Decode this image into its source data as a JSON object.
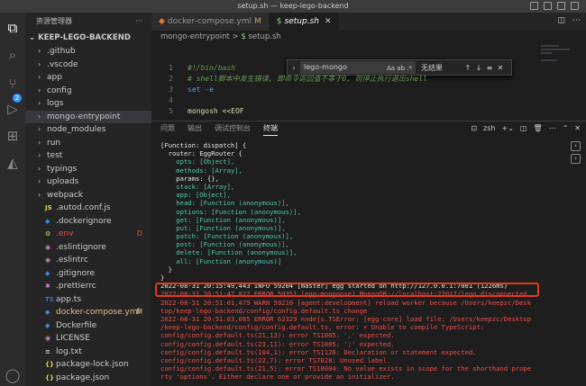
{
  "window": {
    "title": "setup.sh — keep-lego-backend"
  },
  "activity": {
    "scm_badge": "2"
  },
  "sidebar": {
    "header": "资源管理器",
    "more": "···",
    "root": "KEEP-LEGO-BACKEND",
    "items": [
      {
        "kind": "folder",
        "label": ".github",
        "badge": ""
      },
      {
        "kind": "folder",
        "label": ".vscode",
        "badge": ""
      },
      {
        "kind": "folder",
        "label": "app",
        "badge": ""
      },
      {
        "kind": "folder",
        "label": "config",
        "badge": ""
      },
      {
        "kind": "folder",
        "label": "logs",
        "badge": ""
      },
      {
        "kind": "folder",
        "label": "mongo-entrypoint",
        "badge": "",
        "selected": true
      },
      {
        "kind": "folder",
        "label": "node_modules",
        "badge": ""
      },
      {
        "kind": "folder",
        "label": "run",
        "badge": ""
      },
      {
        "kind": "folder",
        "label": "test",
        "badge": ""
      },
      {
        "kind": "folder",
        "label": "typings",
        "badge": ""
      },
      {
        "kind": "folder",
        "label": "uploads",
        "badge": ""
      },
      {
        "kind": "folder",
        "label": "webpack",
        "badge": ""
      },
      {
        "kind": "file",
        "icon": "JS",
        "label": ".autod.conf.js",
        "badge": ""
      },
      {
        "kind": "file",
        "icon": "◆",
        "label": ".dockerignore",
        "badge": ""
      },
      {
        "kind": "file",
        "icon": "⚙",
        "label": ".env",
        "badge": "D"
      },
      {
        "kind": "file",
        "icon": "◉",
        "label": ".eslintignore",
        "badge": ""
      },
      {
        "kind": "file",
        "icon": "◉",
        "label": ".eslintrc",
        "badge": ""
      },
      {
        "kind": "file",
        "icon": "◆",
        "label": ".gitignore",
        "badge": ""
      },
      {
        "kind": "file",
        "icon": "✱",
        "label": ".prettierrc",
        "badge": ""
      },
      {
        "kind": "file",
        "icon": "TS",
        "label": "app.ts",
        "badge": ""
      },
      {
        "kind": "file",
        "icon": "◆",
        "label": "docker-compose.yml",
        "badge": "M"
      },
      {
        "kind": "file",
        "icon": "◆",
        "label": "Dockerfile",
        "badge": ""
      },
      {
        "kind": "file",
        "icon": "◉",
        "label": "LICENSE",
        "badge": ""
      },
      {
        "kind": "file",
        "icon": "≡",
        "label": "log.txt",
        "badge": ""
      },
      {
        "kind": "file",
        "icon": "{}",
        "label": "package-lock.json",
        "badge": ""
      },
      {
        "kind": "file",
        "icon": "{}",
        "label": "package.json",
        "badge": ""
      },
      {
        "kind": "file",
        "icon": "ⓘ",
        "label": "README.md",
        "badge": ""
      }
    ]
  },
  "tabs": [
    {
      "label": "docker-compose.yml",
      "mark": "M",
      "icon": "◆",
      "active": false
    },
    {
      "label": "setup.sh",
      "mark": "",
      "icon": "$",
      "active": true
    }
  ],
  "breadcrumb": {
    "folder": "mongo-entrypoint",
    "sep": ">",
    "file": "setup.sh"
  },
  "find": {
    "value": "lego-mongo",
    "options": "Aa ab .*",
    "result": "无结果"
  },
  "code": [
    {
      "ln": "1",
      "text": "#!/bin/bash",
      "cls": "c-comment"
    },
    {
      "ln": "2",
      "text": "# shell脚本中发生错误, 即命令返回值不等于0, 则停止执行退出shell",
      "cls": "c-comment"
    },
    {
      "ln": "3",
      "text": "set -e",
      "cls": "c-kw"
    },
    {
      "ln": "4",
      "text": "",
      "cls": ""
    },
    {
      "ln": "5",
      "text": "mongosh <<EOF",
      "cls": "c-fn"
    }
  ],
  "panel": {
    "tabs": [
      "问题",
      "输出",
      "调试控制台",
      "终端"
    ],
    "active_tab": "终端",
    "shell": "zsh"
  },
  "terminal": [
    {
      "text": "[Function: dispatch] {",
      "cls": "t-white"
    },
    {
      "text": "  router: EggRouter {",
      "cls": "t-white"
    },
    {
      "text": "    opts: [Object],",
      "cls": "t-cyan"
    },
    {
      "text": "    methods: [Array],",
      "cls": "t-cyan"
    },
    {
      "text": "    params: {},",
      "cls": "t-white"
    },
    {
      "text": "    stack: [Array],",
      "cls": "t-cyan"
    },
    {
      "text": "    app: [Object],",
      "cls": "t-cyan"
    },
    {
      "text": "    head: [Function (anonymous)],",
      "cls": "t-cyan"
    },
    {
      "text": "    options: [Function (anonymous)],",
      "cls": "t-cyan"
    },
    {
      "text": "    get: [Function (anonymous)],",
      "cls": "t-cyan"
    },
    {
      "text": "    put: [Function (anonymous)],",
      "cls": "t-cyan"
    },
    {
      "text": "    patch: [Function (anonymous)],",
      "cls": "t-cyan"
    },
    {
      "text": "    post: [Function (anonymous)],",
      "cls": "t-cyan"
    },
    {
      "text": "    delete: [Function (anonymous)],",
      "cls": "t-cyan"
    },
    {
      "text": "    all: [Function (anonymous)]",
      "cls": "t-cyan"
    },
    {
      "text": "  }",
      "cls": "t-white"
    },
    {
      "text": "}",
      "cls": "t-white"
    },
    {
      "text": "2022-08-31 20:15:49,443 INFO 59204 [master] egg started on http://127.0.0.1:7001 (1226ms)",
      "cls": "t-white"
    },
    {
      "text": "2022-08-31 20:51:47,822 ERROR 59351 [egg-mongoose] MongoDB://localhost:27017/lego disconnected",
      "cls": "t-red"
    },
    {
      "text": "2022-08-31 20:51:01,479 WARN 59210 [agent:development] reload worker because /Users/keepzc/Desk",
      "cls": "t-red"
    },
    {
      "text": "top/keep-lego-backend/config/config.default.ts change",
      "cls": "t-red"
    },
    {
      "text": "2022-08-31 20:51:03,085 ERROR 63329 nodejs.TSError: [egg-core] load file: /Users/keepzc/Desktop",
      "cls": "t-red"
    },
    {
      "text": "/keep-lego-backend/config/config.default.ts, error: × Unable to compile TypeScript:",
      "cls": "t-red"
    },
    {
      "text": "config/config.default.ts(21,13): error TS1005: ',' expected.",
      "cls": "t-red"
    },
    {
      "text": "config/config.default.ts(23,11): error TS1005: ';' expected.",
      "cls": "t-red"
    },
    {
      "text": "config/config.default.ts(104,1): error TS1128: Declaration or statement expected.",
      "cls": "t-red"
    },
    {
      "text": "config/config.default.ts(22,7): error TS7028: Unused label.",
      "cls": "t-red"
    },
    {
      "text": "config/config.default.ts(21,5): error TS18004: No value exists in scope for the shorthand prope",
      "cls": "t-red"
    },
    {
      "text": "rty 'options'. Either declare one or provide an initializer.",
      "cls": "t-red"
    }
  ],
  "colors": {
    "accent": "#3794ff",
    "highlight_box": "#e03a1e",
    "terminal_error": "#f14c4c",
    "terminal_object": "#4ec9b0"
  }
}
